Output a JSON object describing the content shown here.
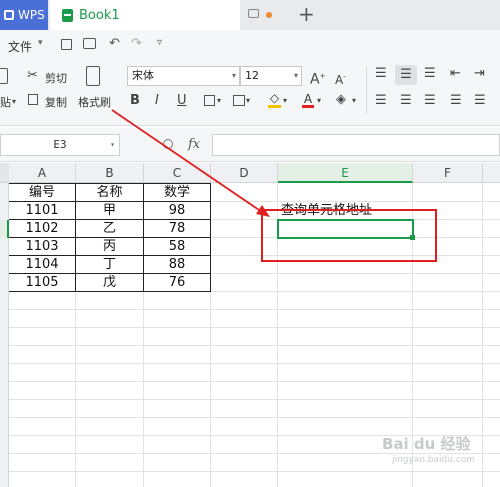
{
  "tabs": {
    "wps_label": "WPS",
    "book_label": "Book1"
  },
  "menu": {
    "file_label": "文件"
  },
  "ribbon": {
    "cut_label": "剪切",
    "copy_label": "复制",
    "format_painter_label": "格式刷",
    "paste_label": "贴",
    "font_name": "宋体",
    "font_size": "12"
  },
  "formula_bar": {
    "cell_ref": "E3",
    "fx_label": "fx",
    "formula": ""
  },
  "columns": [
    "A",
    "B",
    "C",
    "D",
    "E",
    "F"
  ],
  "table": {
    "header": [
      "编号",
      "名称",
      "数学"
    ],
    "rows": [
      [
        "1101",
        "甲",
        "98"
      ],
      [
        "1102",
        "乙",
        "78"
      ],
      [
        "1103",
        "丙",
        "58"
      ],
      [
        "1104",
        "丁",
        "88"
      ],
      [
        "1105",
        "戊",
        "76"
      ]
    ]
  },
  "annotation": {
    "label": "查询单元格地址"
  },
  "watermark": {
    "text": "Bai du 经验",
    "url": "jingyan.baidu.com"
  },
  "colors": {
    "accent": "#1a9b4a",
    "wps_blue": "#4a6fd6",
    "annotation_red": "#e02020"
  }
}
